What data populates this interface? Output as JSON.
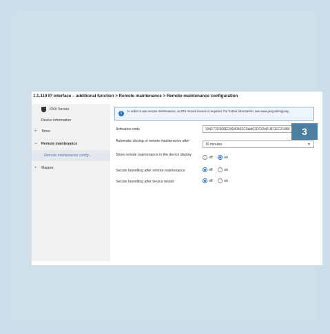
{
  "breadcrumb": "1.1.110 IP interface – additional function > Remote maintenance > Remote maintenance configuration",
  "sidebar": {
    "items": [
      {
        "marker": "",
        "label": "KNX Secure"
      },
      {
        "marker": "",
        "label": "Device information"
      },
      {
        "marker": "+",
        "label": "Timer"
      },
      {
        "marker": "−",
        "label": "Remote maintenance"
      },
      {
        "marker": "",
        "label": "Remote maintenance config..."
      },
      {
        "marker": "+",
        "label": "Mapper"
      }
    ]
  },
  "info": {
    "text": "In order to use remote maintenance, an IPS remote licence is required. For further information, see www.jung.de/myjung."
  },
  "form": {
    "activation_code_label": "Activation code",
    "activation_code_value": "334F72D008ED3040463C9AA02DC094C4F0EC21089",
    "auto_close_label": "Automatic closing of remote maintenance after",
    "auto_close_value": "15 minutes",
    "show_label": "Show remote maintenance in the device display",
    "secure_after_rm_label": "Secure tunnelling after remote maintenance",
    "secure_after_restart_label": "Secure tunnelling after device restart",
    "off_label": "off",
    "on_label": "on"
  },
  "badge": "3"
}
